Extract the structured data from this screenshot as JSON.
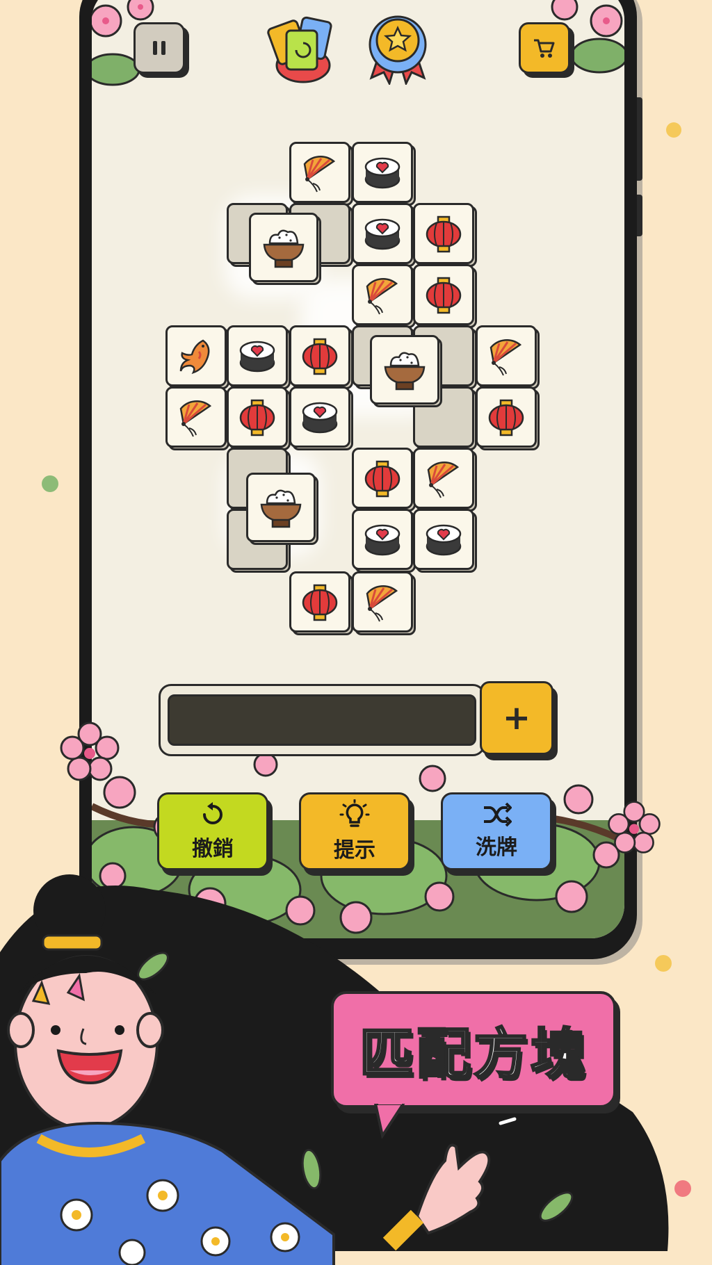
{
  "toolbar": {
    "pause_icon": "pause-icon",
    "cards_icon": "powerup-cards-icon",
    "medal_icon": "medal-icon",
    "shop_icon": "cart-icon"
  },
  "tray": {
    "add_label": "+"
  },
  "actions": [
    {
      "label": "撤銷",
      "icon": "undo-icon",
      "color": "#c3d920"
    },
    {
      "label": "提示",
      "icon": "lightbulb-icon",
      "color": "#f3b928"
    },
    {
      "label": "洗牌",
      "icon": "shuffle-icon",
      "color": "#7ab0f5"
    }
  ],
  "banner": {
    "text": "匹配方塊"
  },
  "colors": {
    "background": "#fbe7c6",
    "screen": "#f3efe2",
    "banner": "#f06fa8"
  }
}
